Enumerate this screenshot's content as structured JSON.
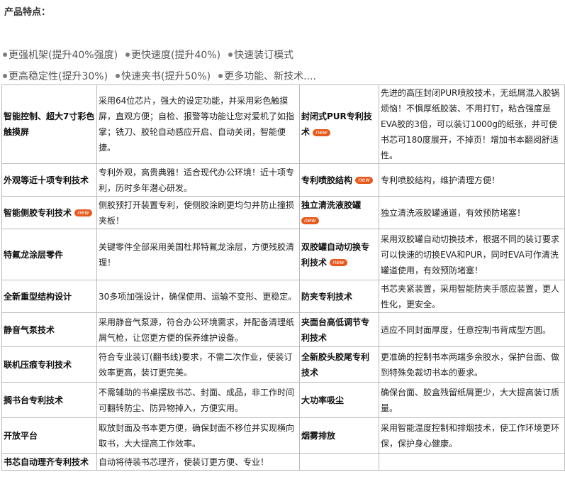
{
  "page_title": "产品特点：",
  "features": [
    [
      "更强机架(提升40%强度)",
      "更快速度(提升40%)",
      "快速装订模式"
    ],
    [
      "更高稳定性(提升30%)",
      "快速夹书(提升50%)",
      "更多功能、新技术...."
    ]
  ],
  "badge_text": "new",
  "rows": [
    {
      "left_label": "智能控制、超大7寸彩色触摸屏",
      "left_desc": "采用64位芯片，强大的设定功能，并采用彩色触摸屏，直观方便；自检、报警等功能让您对爱机了如指掌；铣刀、胶轮自动感应开启、自动关闭，智能便捷。",
      "right_label": "封闭式PUR专利技术",
      "right_new": true,
      "right_desc": "先进的高压封闭PUR喷胶技术，无纸屑混入胶锅烦恼！不惧厚纸胶装、不用打钉，粘合强度是EVA胶的3倍，可以装订1000g的纸张，并可使书芯可180度展开，不掉页！增加书本翻阅舒适性。"
    },
    {
      "left_label": "外观等近十项专利技术",
      "left_desc": "专利外观，高贵典雅！适合现代办公环境！近十项专利，历时多年潜心研发。",
      "right_label": "专利喷胶结构",
      "right_new": true,
      "right_desc": "专利喷胶结构，维护清理方便！"
    },
    {
      "left_label": "智能侧胶专利技术",
      "left_new": true,
      "left_desc": "侧胶预打开装置专利，使侧胶涂刷更均匀并防止撞损夹板！",
      "right_label": "独立清洗液胶罐",
      "right_new": true,
      "right_desc": "独立清洗液胶罐通道，有效预防堵塞！"
    },
    {
      "left_label": "特氟龙涂层零件",
      "left_desc": "关键零件全部采用美国杜邦特氟龙涂层，方便残胶清理！",
      "right_label": "双胶罐自动切换专利技术",
      "right_new": true,
      "right_desc": "采用双胶罐自动切换技术，根据不同的装订要求可以快速的切换EVA和PUR，同时EVA可作清洗罐道使用，有效预防堵塞！"
    },
    {
      "left_label": "全新重型结构设计",
      "left_desc": "30多项加强设计，确保使用、运输不变形、更稳定。",
      "right_label": "防夹专利技术",
      "right_desc": "书芯夹紧装置，采用智能防夹手感应装置，更人性化，更安全。"
    },
    {
      "left_label": "静音气泵技术",
      "left_desc": "采用静音气泵源，符合办公环境需求，并配备清理纸屑气枪，让您更方便的保养维护设备。",
      "right_label": "夹面台高低调节专利技术",
      "right_desc": "适应不同封面厚度，任意控制书背成型方圆。"
    },
    {
      "left_label": "联机压痕专利技术",
      "left_desc": "符合专业装订(翻书线)要求，不需二次作业，使装订效率更高，装订更完美。",
      "right_label": "全新胶头胶尾专利技术",
      "right_desc": "更准确的控制书本两端多余胶水，保护台面、做到特殊免裁切书本的要求。"
    },
    {
      "left_label": "搁书台专利技术",
      "left_desc": "不需辅助的书桌摆放书芯、封面、成品，非工作时间可翻转防尘、防异物掉入，方便实用。",
      "right_label": "大功率吸尘",
      "right_desc": "确保台面、胶盒残留纸屑更少，大大提高装订质量。"
    },
    {
      "left_label": "开放平台",
      "left_desc": "取放封面及书本更方便，确保封面不移位并实现横向取书，大大提高工作效率。",
      "right_label": "烟雾排放",
      "right_desc": "采用智能温度控制和排烟技术，使工作环境更环保，保护身心健康。"
    },
    {
      "left_label": "书芯自动理齐专利技术",
      "left_desc": "自动将待装书芯理齐，使装订更方便、专业！",
      "right_label": "",
      "right_desc": ""
    }
  ]
}
